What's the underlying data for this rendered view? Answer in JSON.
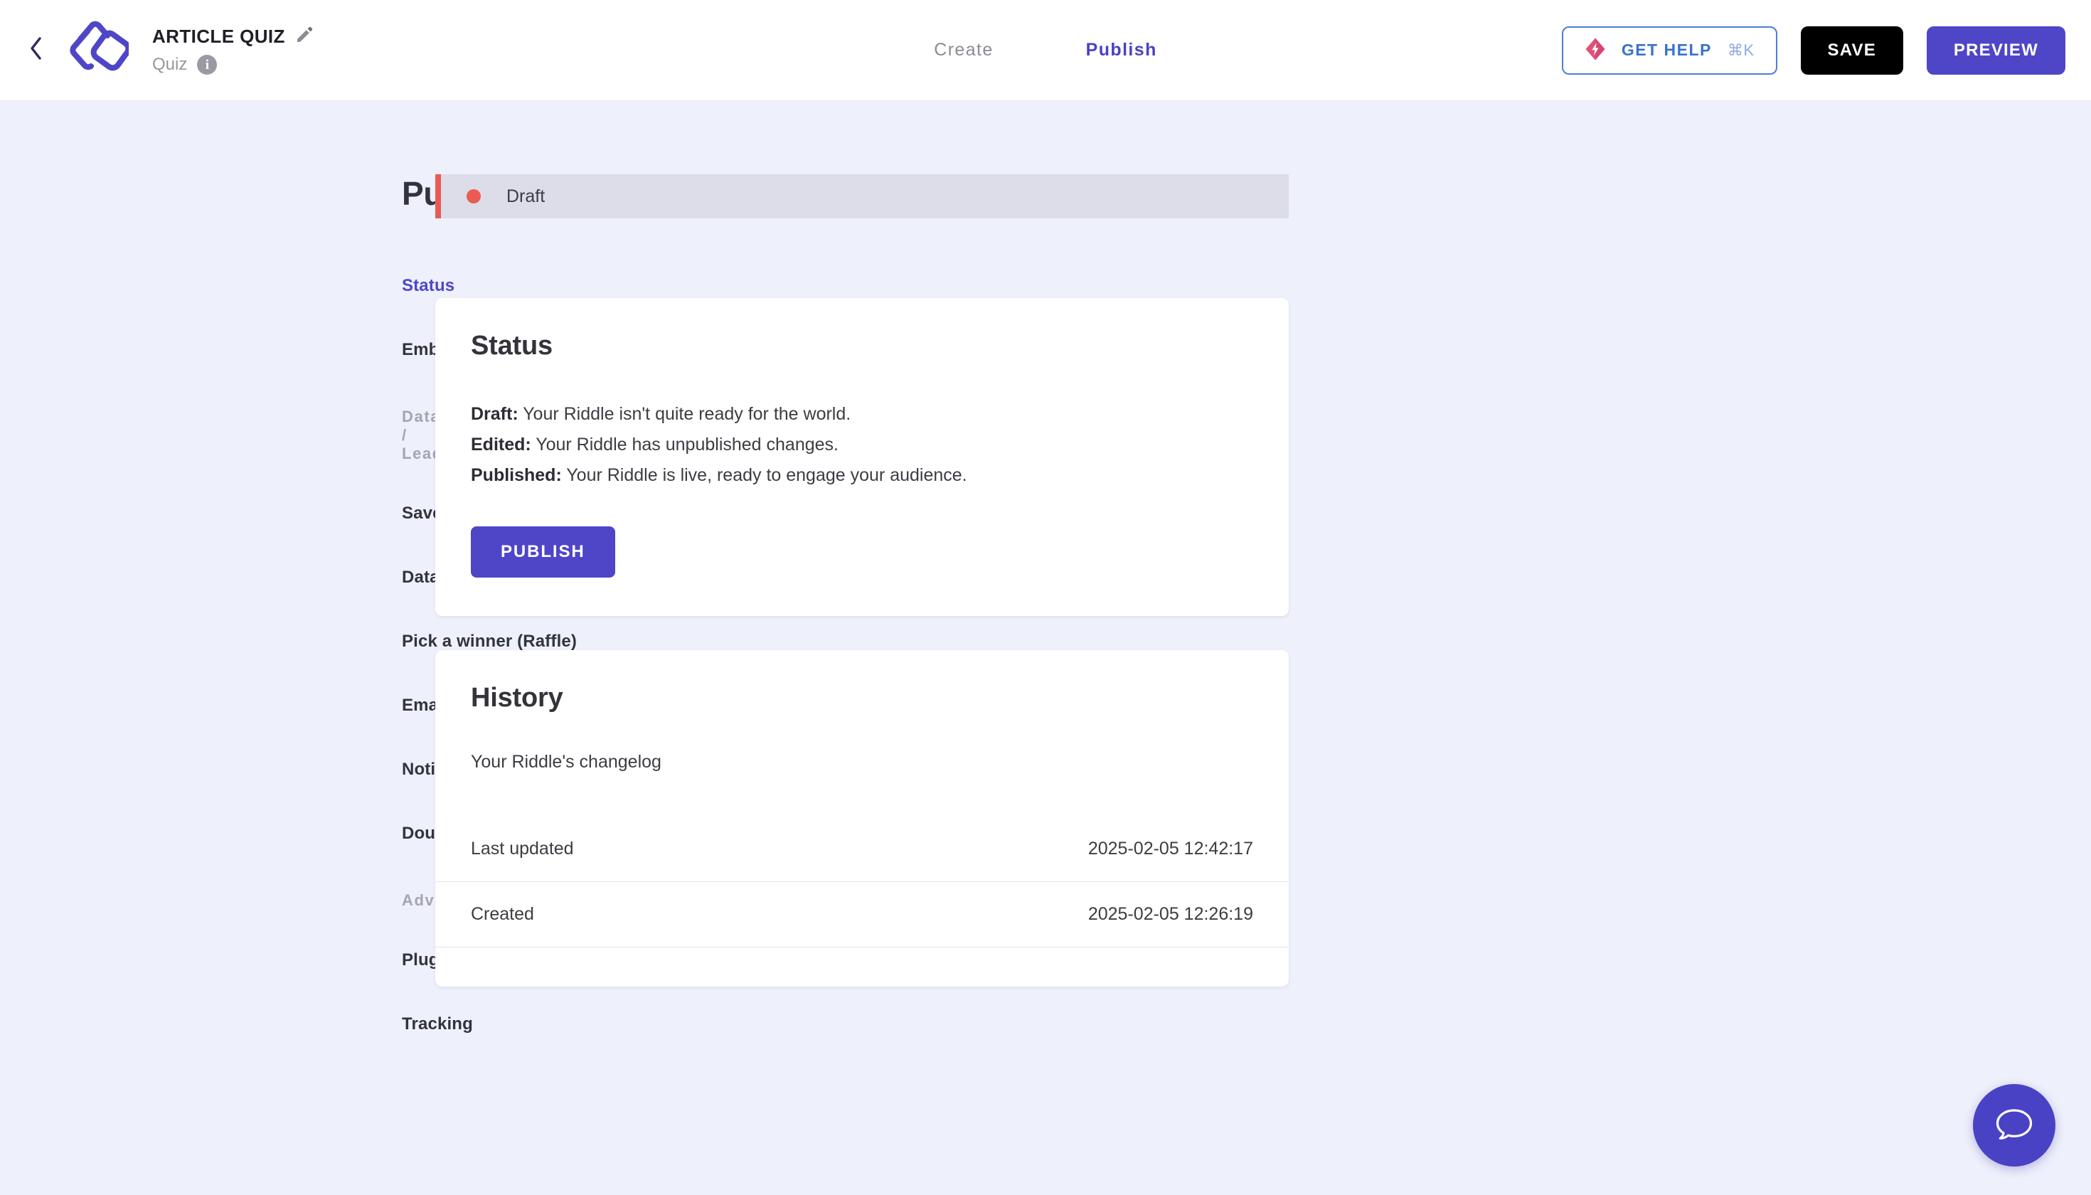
{
  "topbar": {
    "back_icon": "chevron-left-icon",
    "logo_icon": "riddle-logo-icon",
    "doc_title": "ARTICLE QUIZ",
    "edit_icon": "pencil-icon",
    "doc_type": "Quiz",
    "info_icon": "info-icon",
    "tabs": [
      {
        "label": "Create",
        "active": false
      },
      {
        "label": "Publish",
        "active": true
      }
    ],
    "get_help": {
      "icon": "lightning-diamond-icon",
      "label": "GET HELP",
      "shortcut": "⌘K",
      "border_color": "#4a7fd4",
      "text_color": "#3a72cd"
    },
    "save_label": "SAVE",
    "preview_label": "PREVIEW"
  },
  "sidebar": {
    "heading": "Publish",
    "items": [
      {
        "label": "Status",
        "type": "link",
        "active": true
      },
      {
        "label": "Embed / Landing page",
        "type": "link",
        "active": false
      },
      {
        "label": "Data / Leads",
        "type": "group"
      },
      {
        "label": "Save and connect data",
        "type": "link",
        "active": false
      },
      {
        "label": "Data layer",
        "type": "link",
        "active": false
      },
      {
        "label": "Pick a winner (Raffle)",
        "type": "link",
        "active": false
      },
      {
        "label": "Email automation",
        "type": "link",
        "active": false
      },
      {
        "label": "Notification",
        "type": "link",
        "active": false
      },
      {
        "label": "Double opt-in (GDPR)",
        "type": "link",
        "active": false
      },
      {
        "label": "Advanced",
        "type": "group"
      },
      {
        "label": "Plugins",
        "type": "link",
        "active": false
      },
      {
        "label": "Tracking",
        "type": "link",
        "active": false
      }
    ]
  },
  "main": {
    "status_banner": {
      "label": "Draft",
      "dot_color": "#ec5b53",
      "accent_color": "#e85b54",
      "background": "#dcdde8"
    },
    "status_card": {
      "title": "Status",
      "lines": [
        {
          "term": "Draft:",
          "desc": " Your Riddle isn't quite ready for the world."
        },
        {
          "term": "Edited:",
          "desc": " Your Riddle has unpublished changes."
        },
        {
          "term": "Published:",
          "desc": " Your Riddle is live, ready to engage your audience."
        }
      ],
      "publish_label": "PUBLISH",
      "publish_color": "#4f46c7"
    },
    "history_card": {
      "title": "History",
      "subtitle": "Your Riddle's changelog",
      "rows": [
        {
          "label": "Last updated",
          "value": "2025-02-05 12:42:17"
        },
        {
          "label": "Created",
          "value": "2025-02-05 12:26:19"
        }
      ]
    }
  },
  "chat": {
    "icon": "chat-bubble-icon",
    "color": "#4a42c4"
  }
}
